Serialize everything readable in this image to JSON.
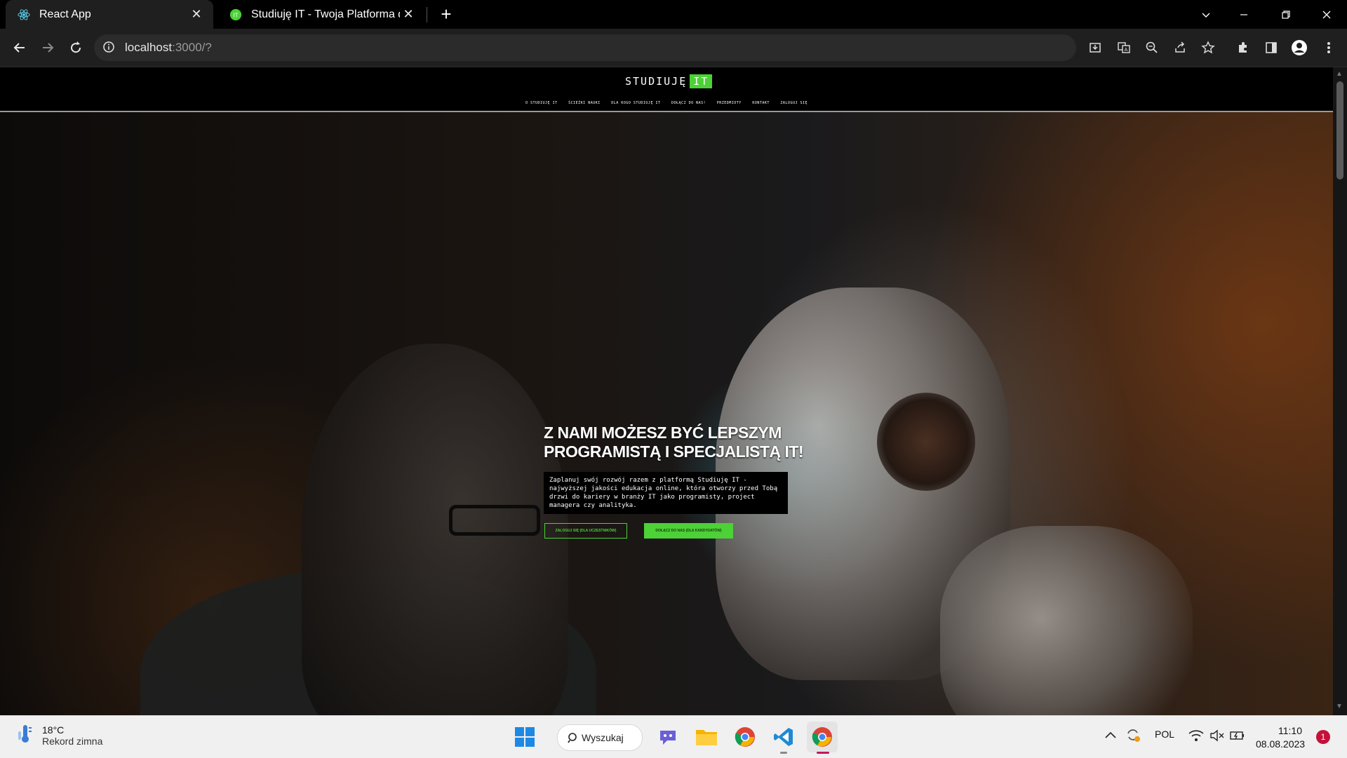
{
  "browser": {
    "tabs": [
      {
        "title": "React App",
        "favicon": "react-icon"
      },
      {
        "title": "Studiuję IT - Twoja Platforma do I",
        "favicon": "it-icon"
      }
    ],
    "url_host": "localhost",
    "url_rest": ":3000/?"
  },
  "site": {
    "logo_text": "STUDIUJĘ",
    "logo_badge": "IT",
    "nav": [
      "O STUDIUJĘ IT",
      "ŚCIEŻKI NAUKI",
      "DLA KOGO STUDIUJĘ IT",
      "DOŁĄCZ DO NAS!",
      "PRZEDMIOTY",
      "KONTAKT",
      "ZALOGUJ SIĘ"
    ],
    "hero": {
      "title_line1": "Z NAMI MOŻESZ BYĆ LEPSZYM",
      "title_line2": "PROGRAMISTĄ I SPECJALISTĄ IT!",
      "description": "Zaplanuj swój rozwój razem z platformą Studiuję IT - najwyższej jakości edukacja online, która otworzy przed Tobą drzwi do kariery w branży IT jako programisty, project managera czy analityka.",
      "btn_login": "ZALOGUJ SIĘ (DLA UCZESTNIKÓW)",
      "btn_join": "DOŁĄCZ DO NAS (DLA KANDYDATÓW)"
    },
    "accent_color": "#4cd137"
  },
  "taskbar": {
    "weather_temp": "18°C",
    "weather_desc": "Rekord zimna",
    "search_label": "Wyszukaj",
    "language": "POL",
    "time": "11:10",
    "date": "08.08.2023",
    "notification_count": "1"
  }
}
